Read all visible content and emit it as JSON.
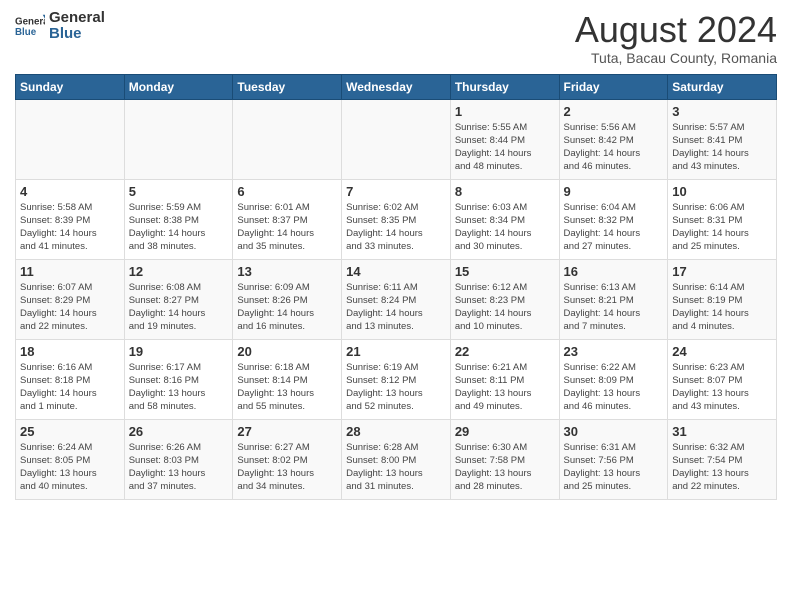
{
  "header": {
    "logo_general": "General",
    "logo_blue": "Blue",
    "month_year": "August 2024",
    "location": "Tuta, Bacau County, Romania"
  },
  "calendar": {
    "days_of_week": [
      "Sunday",
      "Monday",
      "Tuesday",
      "Wednesday",
      "Thursday",
      "Friday",
      "Saturday"
    ],
    "weeks": [
      [
        {
          "day": "",
          "info": ""
        },
        {
          "day": "",
          "info": ""
        },
        {
          "day": "",
          "info": ""
        },
        {
          "day": "",
          "info": ""
        },
        {
          "day": "1",
          "info": "Sunrise: 5:55 AM\nSunset: 8:44 PM\nDaylight: 14 hours\nand 48 minutes."
        },
        {
          "day": "2",
          "info": "Sunrise: 5:56 AM\nSunset: 8:42 PM\nDaylight: 14 hours\nand 46 minutes."
        },
        {
          "day": "3",
          "info": "Sunrise: 5:57 AM\nSunset: 8:41 PM\nDaylight: 14 hours\nand 43 minutes."
        }
      ],
      [
        {
          "day": "4",
          "info": "Sunrise: 5:58 AM\nSunset: 8:39 PM\nDaylight: 14 hours\nand 41 minutes."
        },
        {
          "day": "5",
          "info": "Sunrise: 5:59 AM\nSunset: 8:38 PM\nDaylight: 14 hours\nand 38 minutes."
        },
        {
          "day": "6",
          "info": "Sunrise: 6:01 AM\nSunset: 8:37 PM\nDaylight: 14 hours\nand 35 minutes."
        },
        {
          "day": "7",
          "info": "Sunrise: 6:02 AM\nSunset: 8:35 PM\nDaylight: 14 hours\nand 33 minutes."
        },
        {
          "day": "8",
          "info": "Sunrise: 6:03 AM\nSunset: 8:34 PM\nDaylight: 14 hours\nand 30 minutes."
        },
        {
          "day": "9",
          "info": "Sunrise: 6:04 AM\nSunset: 8:32 PM\nDaylight: 14 hours\nand 27 minutes."
        },
        {
          "day": "10",
          "info": "Sunrise: 6:06 AM\nSunset: 8:31 PM\nDaylight: 14 hours\nand 25 minutes."
        }
      ],
      [
        {
          "day": "11",
          "info": "Sunrise: 6:07 AM\nSunset: 8:29 PM\nDaylight: 14 hours\nand 22 minutes."
        },
        {
          "day": "12",
          "info": "Sunrise: 6:08 AM\nSunset: 8:27 PM\nDaylight: 14 hours\nand 19 minutes."
        },
        {
          "day": "13",
          "info": "Sunrise: 6:09 AM\nSunset: 8:26 PM\nDaylight: 14 hours\nand 16 minutes."
        },
        {
          "day": "14",
          "info": "Sunrise: 6:11 AM\nSunset: 8:24 PM\nDaylight: 14 hours\nand 13 minutes."
        },
        {
          "day": "15",
          "info": "Sunrise: 6:12 AM\nSunset: 8:23 PM\nDaylight: 14 hours\nand 10 minutes."
        },
        {
          "day": "16",
          "info": "Sunrise: 6:13 AM\nSunset: 8:21 PM\nDaylight: 14 hours\nand 7 minutes."
        },
        {
          "day": "17",
          "info": "Sunrise: 6:14 AM\nSunset: 8:19 PM\nDaylight: 14 hours\nand 4 minutes."
        }
      ],
      [
        {
          "day": "18",
          "info": "Sunrise: 6:16 AM\nSunset: 8:18 PM\nDaylight: 14 hours\nand 1 minute."
        },
        {
          "day": "19",
          "info": "Sunrise: 6:17 AM\nSunset: 8:16 PM\nDaylight: 13 hours\nand 58 minutes."
        },
        {
          "day": "20",
          "info": "Sunrise: 6:18 AM\nSunset: 8:14 PM\nDaylight: 13 hours\nand 55 minutes."
        },
        {
          "day": "21",
          "info": "Sunrise: 6:19 AM\nSunset: 8:12 PM\nDaylight: 13 hours\nand 52 minutes."
        },
        {
          "day": "22",
          "info": "Sunrise: 6:21 AM\nSunset: 8:11 PM\nDaylight: 13 hours\nand 49 minutes."
        },
        {
          "day": "23",
          "info": "Sunrise: 6:22 AM\nSunset: 8:09 PM\nDaylight: 13 hours\nand 46 minutes."
        },
        {
          "day": "24",
          "info": "Sunrise: 6:23 AM\nSunset: 8:07 PM\nDaylight: 13 hours\nand 43 minutes."
        }
      ],
      [
        {
          "day": "25",
          "info": "Sunrise: 6:24 AM\nSunset: 8:05 PM\nDaylight: 13 hours\nand 40 minutes."
        },
        {
          "day": "26",
          "info": "Sunrise: 6:26 AM\nSunset: 8:03 PM\nDaylight: 13 hours\nand 37 minutes."
        },
        {
          "day": "27",
          "info": "Sunrise: 6:27 AM\nSunset: 8:02 PM\nDaylight: 13 hours\nand 34 minutes."
        },
        {
          "day": "28",
          "info": "Sunrise: 6:28 AM\nSunset: 8:00 PM\nDaylight: 13 hours\nand 31 minutes."
        },
        {
          "day": "29",
          "info": "Sunrise: 6:30 AM\nSunset: 7:58 PM\nDaylight: 13 hours\nand 28 minutes."
        },
        {
          "day": "30",
          "info": "Sunrise: 6:31 AM\nSunset: 7:56 PM\nDaylight: 13 hours\nand 25 minutes."
        },
        {
          "day": "31",
          "info": "Sunrise: 6:32 AM\nSunset: 7:54 PM\nDaylight: 13 hours\nand 22 minutes."
        }
      ]
    ]
  }
}
